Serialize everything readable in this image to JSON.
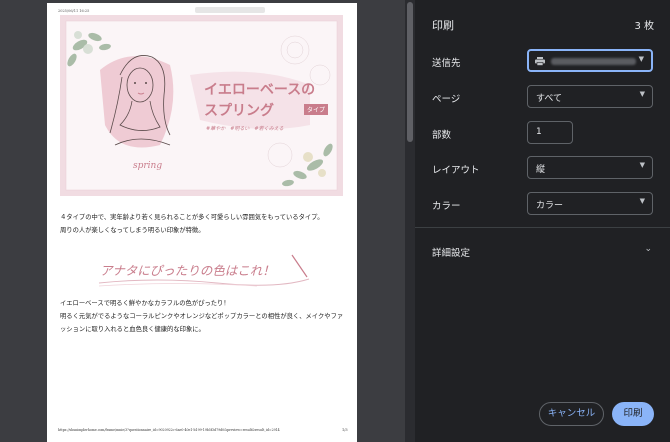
{
  "preview": {
    "header_left": "2025/06/11 16:25",
    "banner": {
      "title_line1": "イエローベースの",
      "title_line2": "スプリング",
      "type_badge": "タイプ",
      "tags": "#華やか　#明るい　#若くみえる",
      "script_word": "spring"
    },
    "paragraph1": [
      "４タイプの中で、実年齢より若く見られることが多く可愛らしい雰囲気をもっているタイプ。",
      "周りの人が楽しくなってしまう明るい印象が特徴。"
    ],
    "heading2": "アナタにぴったりの色はこれ！",
    "paragraph2": [
      "イエローベースで明るく鮮やかなカラフルの色がぴったり！",
      "明るく元気がでるようなコーラルピンクやオレンジなどポップカラーとの相性が良く、メイクやファ",
      "ッションに取り入れると血色良く健康的な印象に。"
    ],
    "footer_url": "https://shunimplerhome.com/frame/mnie/3?questionnaire_id=9020922c-6ae0-40e1-b199-19b5f3d79d0&preview=result&result_id=2914",
    "footer_page": "1/3"
  },
  "panel": {
    "title": "印刷",
    "sheet_count": "3 枚",
    "destination_label": "送信先",
    "pages_label": "ページ",
    "pages_value": "すべて",
    "copies_label": "部数",
    "copies_value": "1",
    "layout_label": "レイアウト",
    "layout_value": "縦",
    "color_label": "カラー",
    "color_value": "カラー",
    "advanced_label": "詳細設定",
    "cancel_button": "キャンセル",
    "print_button": "印刷"
  },
  "colors": {
    "panel_bg": "#202124",
    "accent": "#8ab4f8",
    "pink": "#c97d8c"
  }
}
